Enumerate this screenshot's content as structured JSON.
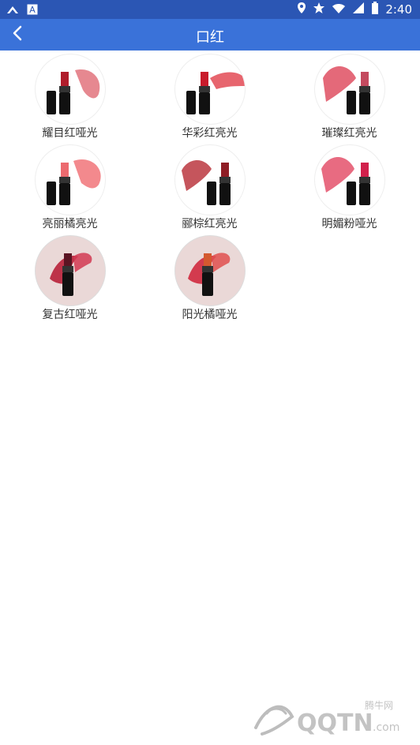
{
  "status_bar": {
    "time": "2:40",
    "icons": [
      "app-icon",
      "a-box-icon",
      "location-icon",
      "star-icon",
      "wifi-icon",
      "signal-icon",
      "battery-icon"
    ]
  },
  "app_bar": {
    "title": "口红",
    "back_icon": "chevron-left-icon"
  },
  "items": [
    {
      "label": "耀目红哑光"
    },
    {
      "label": "华彩红亮光"
    },
    {
      "label": "璀璨红亮光"
    },
    {
      "label": "亮丽橘亮光"
    },
    {
      "label": "郦棕红亮光"
    },
    {
      "label": "明媚粉哑光"
    },
    {
      "label": "复古红哑光"
    },
    {
      "label": "阳光橘哑光"
    }
  ],
  "watermark": {
    "site_cn": "腾牛网",
    "site_en": "QQTN.com"
  },
  "colors": {
    "status_bar_bg": "#2b56b4",
    "app_bar_bg": "#3a72d9",
    "text": "#333333"
  }
}
